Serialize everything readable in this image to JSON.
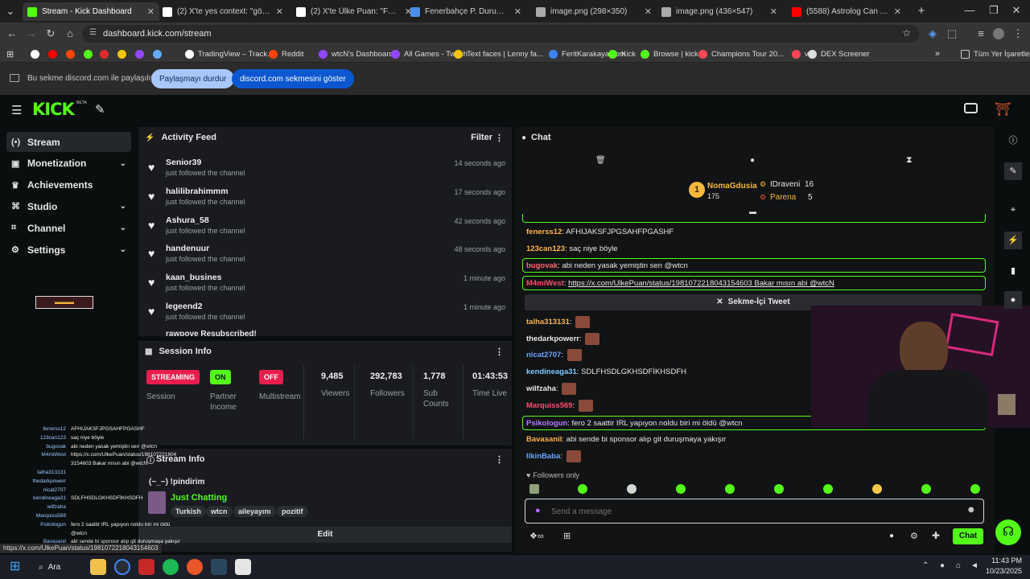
{
  "browser": {
    "tabs": [
      {
        "title": "Stream - Kick Dashboard",
        "favicon_color": "#53fc18",
        "active": true
      },
      {
        "title": "(2) X'te yes context: \"gözümüze",
        "favicon_color": "#ffffff",
        "active": false
      },
      {
        "title": "(2) X'te Ülke Puan: \"Fenerbahçe",
        "favicon_color": "#ffffff",
        "active": false
      },
      {
        "title": "Fenerbahçe P. Durumu | Mackolik",
        "favicon_color": "#4a8ee8",
        "active": false
      },
      {
        "title": "image.png (298×350)",
        "favicon_color": "#aaaaaa",
        "active": false
      },
      {
        "title": "image.png (436×547)",
        "favicon_color": "#aaaaaa",
        "active": false
      },
      {
        "title": "(5588) Astrolog Can Aydoğmuş",
        "favicon_color": "#ff0000",
        "active": false
      }
    ],
    "new_tab": "+",
    "url": "dashboard.kick.com/stream",
    "bookmarks": [
      {
        "label": "",
        "color": "#ffffff"
      },
      {
        "label": "",
        "color": "#ff0000"
      },
      {
        "label": "",
        "color": "#ff4500"
      },
      {
        "label": "",
        "color": "#53fc18"
      },
      {
        "label": "",
        "color": "#e02b2b"
      },
      {
        "label": "",
        "color": "#f1c40f"
      },
      {
        "label": "",
        "color": "#9146ff"
      },
      {
        "label": "",
        "color": "#66aaff"
      },
      {
        "label": "TradingView – Track...",
        "color": "#ffffff"
      },
      {
        "label": "Reddit",
        "color": "#ff4500"
      },
      {
        "label": "wtcN's Dashboard",
        "color": "#9146ff"
      },
      {
        "label": "All Games - Twitch",
        "color": "#9146ff"
      },
      {
        "label": "Text faces | Lenny fa...",
        "color": "#f1c40f"
      },
      {
        "label": "FeritKarakaya.com",
        "color": "#3b82f6"
      },
      {
        "label": "Kick",
        "color": "#53fc18"
      },
      {
        "label": "Browse | kick",
        "color": "#53fc18"
      },
      {
        "label": "Champions Tour 20...",
        "color": "#ff4655"
      },
      {
        "label": "vlr",
        "color": "#ff4655"
      },
      {
        "label": "DEX Screener",
        "color": "#dddddd"
      }
    ],
    "bookmarks_overflow": "»",
    "all_bookmarks": "Tüm Yer İşaretleri"
  },
  "sharebar": {
    "text": "Bu sekme discord.com ile paylaşılıyor",
    "stop_button": "Paylaşmayı durdur",
    "show_button": "discord.com sekmesini göster"
  },
  "kick": {
    "logo": "KICK",
    "beta": "BETA",
    "sidebar": [
      {
        "label": "Stream",
        "icon": "broadcast-icon",
        "glyph": "(•)",
        "expandable": false,
        "active": true
      },
      {
        "label": "Monetization",
        "icon": "money-icon",
        "glyph": "▣",
        "expandable": true,
        "active": false
      },
      {
        "label": "Achievements",
        "icon": "trophy-icon",
        "glyph": "♛",
        "expandable": false,
        "active": false
      },
      {
        "label": "Studio",
        "icon": "studio-icon",
        "glyph": "⌘",
        "expandable": true,
        "active": false
      },
      {
        "label": "Channel",
        "icon": "channel-icon",
        "glyph": "⌗",
        "expandable": true,
        "active": false
      },
      {
        "label": "Settings",
        "icon": "gear-icon",
        "glyph": "⚙",
        "expandable": true,
        "active": false
      }
    ],
    "activity": {
      "title": "Activity Feed",
      "filter": "Filter",
      "items": [
        {
          "name": "Senior39",
          "action": "just followed the channel",
          "time": "14 seconds ago"
        },
        {
          "name": "halilibrahimmm",
          "action": "just followed the channel",
          "time": "17 seconds ago"
        },
        {
          "name": "Ashura_58",
          "action": "just followed the channel",
          "time": "42 seconds ago"
        },
        {
          "name": "handenuur",
          "action": "just followed the channel",
          "time": "48 seconds ago"
        },
        {
          "name": "kaan_busines",
          "action": "just followed the channel",
          "time": "1 minute ago"
        },
        {
          "name": "legeend2",
          "action": "just followed the channel",
          "time": "1 minute ago"
        }
      ],
      "partial_last": "rawpove Resubscribed!"
    },
    "session": {
      "title": "Session Info",
      "status": [
        {
          "badge": "STREAMING",
          "label": "Session",
          "color": "#e91e4d"
        },
        {
          "badge": "ON",
          "label": "Partner Income",
          "color": "#53fc18"
        },
        {
          "badge": "OFF",
          "label": "Multistream",
          "color": "#e91e4d"
        }
      ],
      "stats": [
        {
          "value": "9,485",
          "label": "Viewers"
        },
        {
          "value": "292,783",
          "label": "Followers"
        },
        {
          "value": "1,778",
          "label": "Sub Counts"
        },
        {
          "value": "01:43:53",
          "label": "Time Live"
        }
      ]
    },
    "stream_info": {
      "title": "Stream Info",
      "stream_title": "(~_~) !pindirim",
      "category": "Just Chatting",
      "tags": [
        "Turkish",
        "wtcn",
        "aileyayını",
        "pozitif"
      ],
      "edit": "Edit"
    },
    "chat": {
      "title": "Chat",
      "top": [
        {
          "rank": "1",
          "name": "NomaGdusia",
          "count": "175"
        },
        {
          "name": "IDraveni",
          "count": "16"
        },
        {
          "name": "Parena",
          "count": "5"
        }
      ],
      "messages": [
        {
          "user": "fenerss12",
          "color": "#ffb347",
          "text": "AFHIJAKSFJPGSAHFPGASHF",
          "highlight": false,
          "emote": false
        },
        {
          "user": "123can123",
          "color": "#ffb347",
          "text": "saç niye böyle",
          "highlight": false,
          "emote": false
        },
        {
          "user": "bugovak",
          "color": "#ff6b6b",
          "text": "abi neden yasak yemiştin sen @wtcn",
          "highlight": true,
          "emote": false
        },
        {
          "user": "M4miWest",
          "color": "#ff4d6d",
          "text": "https://x.com/UlkePuan/status/1981072218043154603 Bakar mısın abi @wtcN",
          "highlight": true,
          "emote": false
        },
        {
          "user": "talha313131",
          "color": "#ffb347",
          "text": "",
          "highlight": false,
          "emote": true
        },
        {
          "user": "thedarkpowerr",
          "color": "#e8e8e8",
          "text": "",
          "highlight": false,
          "emote": true
        },
        {
          "user": "nicat2707",
          "color": "#6aa6ff",
          "text": "",
          "highlight": false,
          "emote": true
        },
        {
          "user": "kendineaga31",
          "color": "#7ec8ff",
          "text": "SDLFHSDLGKHSDFİKHSDFH",
          "highlight": false,
          "emote": false
        },
        {
          "user": "wilfzaha",
          "color": "#e8e8e8",
          "text": "",
          "highlight": false,
          "emote": true
        },
        {
          "user": "Marquiss569",
          "color": "#ff4d6d",
          "text": "",
          "highlight": false,
          "emote": true
        },
        {
          "user": "Psikologun",
          "color": "#b07cff",
          "text": "fero 2 saattir IRL yapıyon noldu biri mi öldü @wtcn",
          "highlight": true,
          "emote": false
        },
        {
          "user": "Bavasanil",
          "color": "#ffb347",
          "text": "abi sende bi sponsor alıp git duruşmaya yakışır",
          "highlight": false,
          "emote": false
        },
        {
          "user": "IlkinBaba",
          "color": "#6aa6ff",
          "text": "",
          "highlight": false,
          "emote": true
        }
      ],
      "tweet_button": "Sekme-İçi Tweet",
      "followers_only": "Followers only",
      "input_placeholder": "Send a message",
      "send": "Chat"
    },
    "mini_chat": [
      {
        "user": "fenerss12",
        "text": "AFHIJAKSFJPGSAHFPGASHF"
      },
      {
        "user": "123can123",
        "text": "saç niye böyle"
      },
      {
        "user": "bugovak",
        "text": "abi neden yasak yemiştin sen @wtcn"
      },
      {
        "user": "M4miWest",
        "text": "https://x.com/UlkePuan/status/198107221804"
      },
      {
        "user": "",
        "text": "3154603 Bakar mısın abi @wtcN"
      },
      {
        "user": "talha313131",
        "text": ""
      },
      {
        "user": "thedarkpowerr",
        "text": ""
      },
      {
        "user": "nicat2707",
        "text": ""
      },
      {
        "user": "kendineaga31",
        "text": "SDLFHSDLGKHSDFİKHSDFH"
      },
      {
        "user": "wilfzaha",
        "text": ""
      },
      {
        "user": "Marquiss569",
        "text": ""
      },
      {
        "user": "Psikologun",
        "text": "fero 2 saattir IRL yapıyon noldu biri mi öldü"
      },
      {
        "user": "",
        "text": "@wtcn"
      },
      {
        "user": "Bavasanil",
        "text": "abi sende bi sponsor alıp git duruşmaya yakışır"
      },
      {
        "user": "IlkinBaba",
        "text": ""
      }
    ]
  },
  "status_url": "https://x.com/UlkePuan/status/1981072218043154603",
  "taskbar": {
    "search": "Ara",
    "time": "11:43 PM",
    "date": "10/23/2025"
  },
  "colors": {
    "accent": "#53fc18",
    "streaming": "#e91e4d"
  }
}
